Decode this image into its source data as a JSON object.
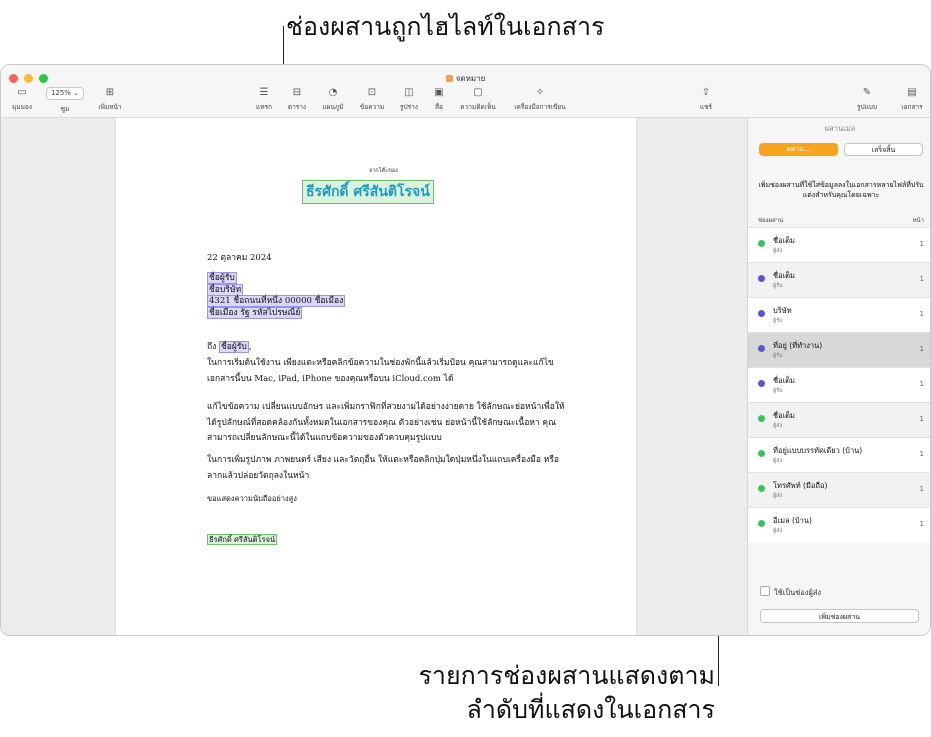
{
  "callouts": {
    "top": "ช่องผสานถูกไฮไลท์ในเอกสาร",
    "bottom_line1": "รายการช่องผสานแสดงตาม",
    "bottom_line2": "ลำดับที่แสดงในเอกสาร"
  },
  "window": {
    "title": "จดหมาย",
    "traffic_light_colors": [
      "#ff5f57",
      "#febc2e",
      "#28c840"
    ]
  },
  "toolbar": {
    "view": "มุมมอง",
    "zoom_value": "125%",
    "zoom_label": "ซูม",
    "add_page": "เพิ่มหน้า",
    "insert": "แทรก",
    "table": "ตาราง",
    "chart": "แผนภูมิ",
    "text": "ข้อความ",
    "shape": "รูปร่าง",
    "media": "สื่อ",
    "comment": "ความคิดเห็น",
    "writing_tools": "เครื่องมือการเขียน",
    "share": "แชร์",
    "format": "รูปแบบ",
    "document": "เอกสาร"
  },
  "document": {
    "from_label": "จากโต๊ะของ",
    "sender_name": "ธีรศักดิ์ ศรีสันติโรจน์",
    "date": "22 ตุลาคม 2024",
    "address": [
      "ชื่อผู้รับ",
      "ชื่อบริษัท",
      "4321 ชื่อถนนที่หนึ่ง 00000 ชื่อเมือง",
      "ชื่อเมือง รัฐ รหัสไปรษณีย์"
    ],
    "greeting_prefix": "ถึง",
    "greeting_field": "ชื่อผู้รับ",
    "greeting_suffix": ",",
    "para1": "ในการเริ่มต้นใช้งาน เพียงแตะหรือคลิกข้อความในช่องพักนี้แล้วเริ่มป้อน คุณสามารถดูและแก้ไขเอกสารนี้บน Mac, iPad, iPhone ของคุณหรือบน iCloud.com ได้",
    "para2": "แก้ไขข้อความ เปลี่ยนแบบอักษร และเพิ่มกราฟิกที่สวยงามได้อย่างง่ายดาย ใช้ลักษณะย่อหน้าเพื่อให้ได้รูปลักษณ์ที่สอดคล้องกันทั้งหมดในเอกสารของคุณ ตัวอย่างเช่น ย่อหน้านี้ใช้ลักษณะเนื้อหา คุณสามารถเปลี่ยนลักษณะนี้ได้ในแถบข้อความของตัวควบคุมรูปแบบ",
    "para3": "ในการเพิ่มรูปภาพ ภาพยนตร์ เสียง และวัตถุอื่น ให้แตะหรือคลิกปุ่มใดปุ่มหนึ่งในแถบเครื่องมือ หรือลากแล้วปล่อยวัตถุลงในหน้า",
    "closing": "ขอแสดงความนับถืออย่างสูง",
    "signature": "ธีรศักดิ์ ศรีสันติโรจน์"
  },
  "panel": {
    "title": "ผสานเมล",
    "merge_button": "ผสาน...",
    "done_button": "เสร็จสิ้น",
    "description": "เพิ่มช่องผสานที่ใช้ใส่ข้อมูลลงในเอกสารหลายไฟล์ที่ปรับแต่งสำหรับคุณโดยเฉพาะ",
    "col_field": "ช่องผสาน",
    "col_page": "หน้า",
    "fields": [
      {
        "name": "ชื่อเต็ม",
        "role": "ผู้ส่ง",
        "page": "1",
        "color": "#34c759"
      },
      {
        "name": "ชื่อเต็ม",
        "role": "ผู้รับ",
        "page": "1",
        "color": "#5856d6"
      },
      {
        "name": "บริษัท",
        "role": "ผู้รับ",
        "page": "1",
        "color": "#5856d6"
      },
      {
        "name": "ที่อยู่ (ที่ทำงาน)",
        "role": "ผู้รับ",
        "page": "1",
        "color": "#5856d6"
      },
      {
        "name": "ชื่อเต็ม",
        "role": "ผู้รับ",
        "page": "1",
        "color": "#5856d6"
      },
      {
        "name": "ชื่อเต็ม",
        "role": "ผู้ส่ง",
        "page": "1",
        "color": "#34c759"
      },
      {
        "name": "ที่อยู่แบบบรรทัดเดียว (บ้าน)",
        "role": "ผู้ส่ง",
        "page": "1",
        "color": "#34c759"
      },
      {
        "name": "โทรศัพท์ (มือถือ)",
        "role": "ผู้ส่ง",
        "page": "1",
        "color": "#34c759"
      },
      {
        "name": "อีเมล (บ้าน)",
        "role": "ผู้ส่ง",
        "page": "1",
        "color": "#34c759"
      }
    ],
    "use_sender_label": "ใช้เป็นช่องผู้ส่ง",
    "add_field_button": "เพิ่มช่องผสาน"
  }
}
